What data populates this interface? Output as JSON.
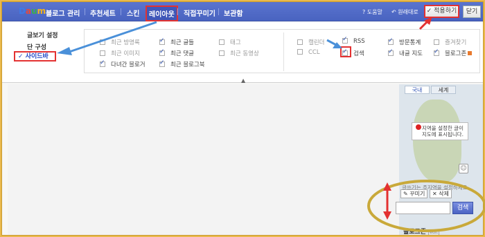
{
  "header": {
    "logo": [
      "D",
      "a",
      "u",
      "m"
    ],
    "logo_colors": [
      "#3d7be6",
      "#e64a3d",
      "#3db04a",
      "#f2b51e"
    ],
    "title": "블로그 관리",
    "nav": [
      "추천세트",
      "스킨",
      "레이아웃",
      "직접꾸미기",
      "보관함"
    ],
    "active_nav_index": 2,
    "help": "? 도움말",
    "restore": "↶ 원래대로",
    "apply": "✓ 적용하기",
    "close": "닫기"
  },
  "side_menu": {
    "items": [
      "글보기 설정",
      "단 구성",
      "✓ 사이드바"
    ],
    "active_index": 2
  },
  "options": {
    "items": [
      {
        "label": "최근 방명록",
        "checked": false
      },
      {
        "label": "최근 이미지",
        "checked": false
      },
      {
        "label": "다녀간 블로거",
        "checked": true
      },
      {
        "label": "최근 글들",
        "checked": true
      },
      {
        "label": "최근 댓글",
        "checked": true
      },
      {
        "label": "최근 블로그북",
        "checked": true
      },
      {
        "label": "태그",
        "checked": false
      },
      {
        "label": "최근 동영상",
        "checked": false
      },
      {
        "label": "캘린더",
        "checked": false
      },
      {
        "label": "CCL",
        "checked": false
      },
      {
        "label": "RSS",
        "checked": true
      },
      {
        "label": "검색",
        "checked": true
      },
      {
        "label": "방문통계",
        "checked": true
      },
      {
        "label": "내글 지도",
        "checked": true
      },
      {
        "label": "즐겨찾기",
        "checked": false
      },
      {
        "label": "블로그존",
        "checked": true
      }
    ],
    "collapse": "▲"
  },
  "preview": {
    "map_tabs": [
      "국내",
      "세계"
    ],
    "map_note": "지역을 설정한 글이 지도에 표시됩니다.",
    "map_caption": "글쓰기는 주지역을 설정하세요",
    "edit_btn": "꾸미기",
    "delete_btn": "✕ 삭제",
    "search_btn": "검색",
    "blog_zone_title": "블로그존",
    "edit_badge": "edit"
  },
  "colors": {
    "nav_bg": "#4963c0",
    "highlight": "#e33131",
    "annotation_blue": "#4a90d9",
    "annotation_ellipse": "#c9a93a"
  }
}
